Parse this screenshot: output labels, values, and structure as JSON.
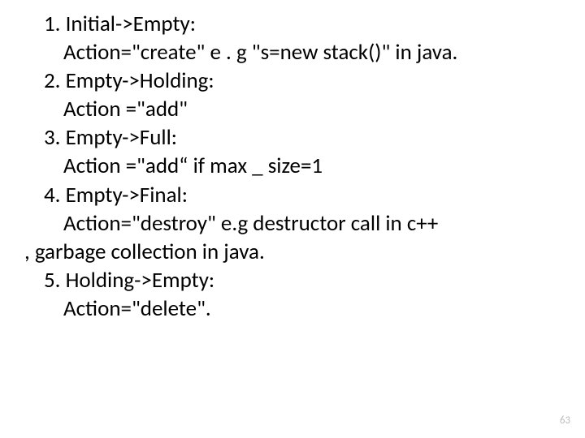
{
  "lines": {
    "l1": "1. Initial->Empty:",
    "l2": "Action=\"create\" e . g \"s=new stack()\" in java.",
    "l3": "2. Empty->Holding:",
    "l4": "Action =\"add\"",
    "l5": "3. Empty->Full:",
    "l6": "Action =\"add“ if max _ size=1",
    "l7": "4. Empty->Final:",
    "l8": "Action=\"destroy\" e.g destructor call in c++",
    "l9": ", garbage collection in java.",
    "l10": "5. Holding->Empty:",
    "l11": "Action=\"delete\"."
  },
  "page_number": "63"
}
